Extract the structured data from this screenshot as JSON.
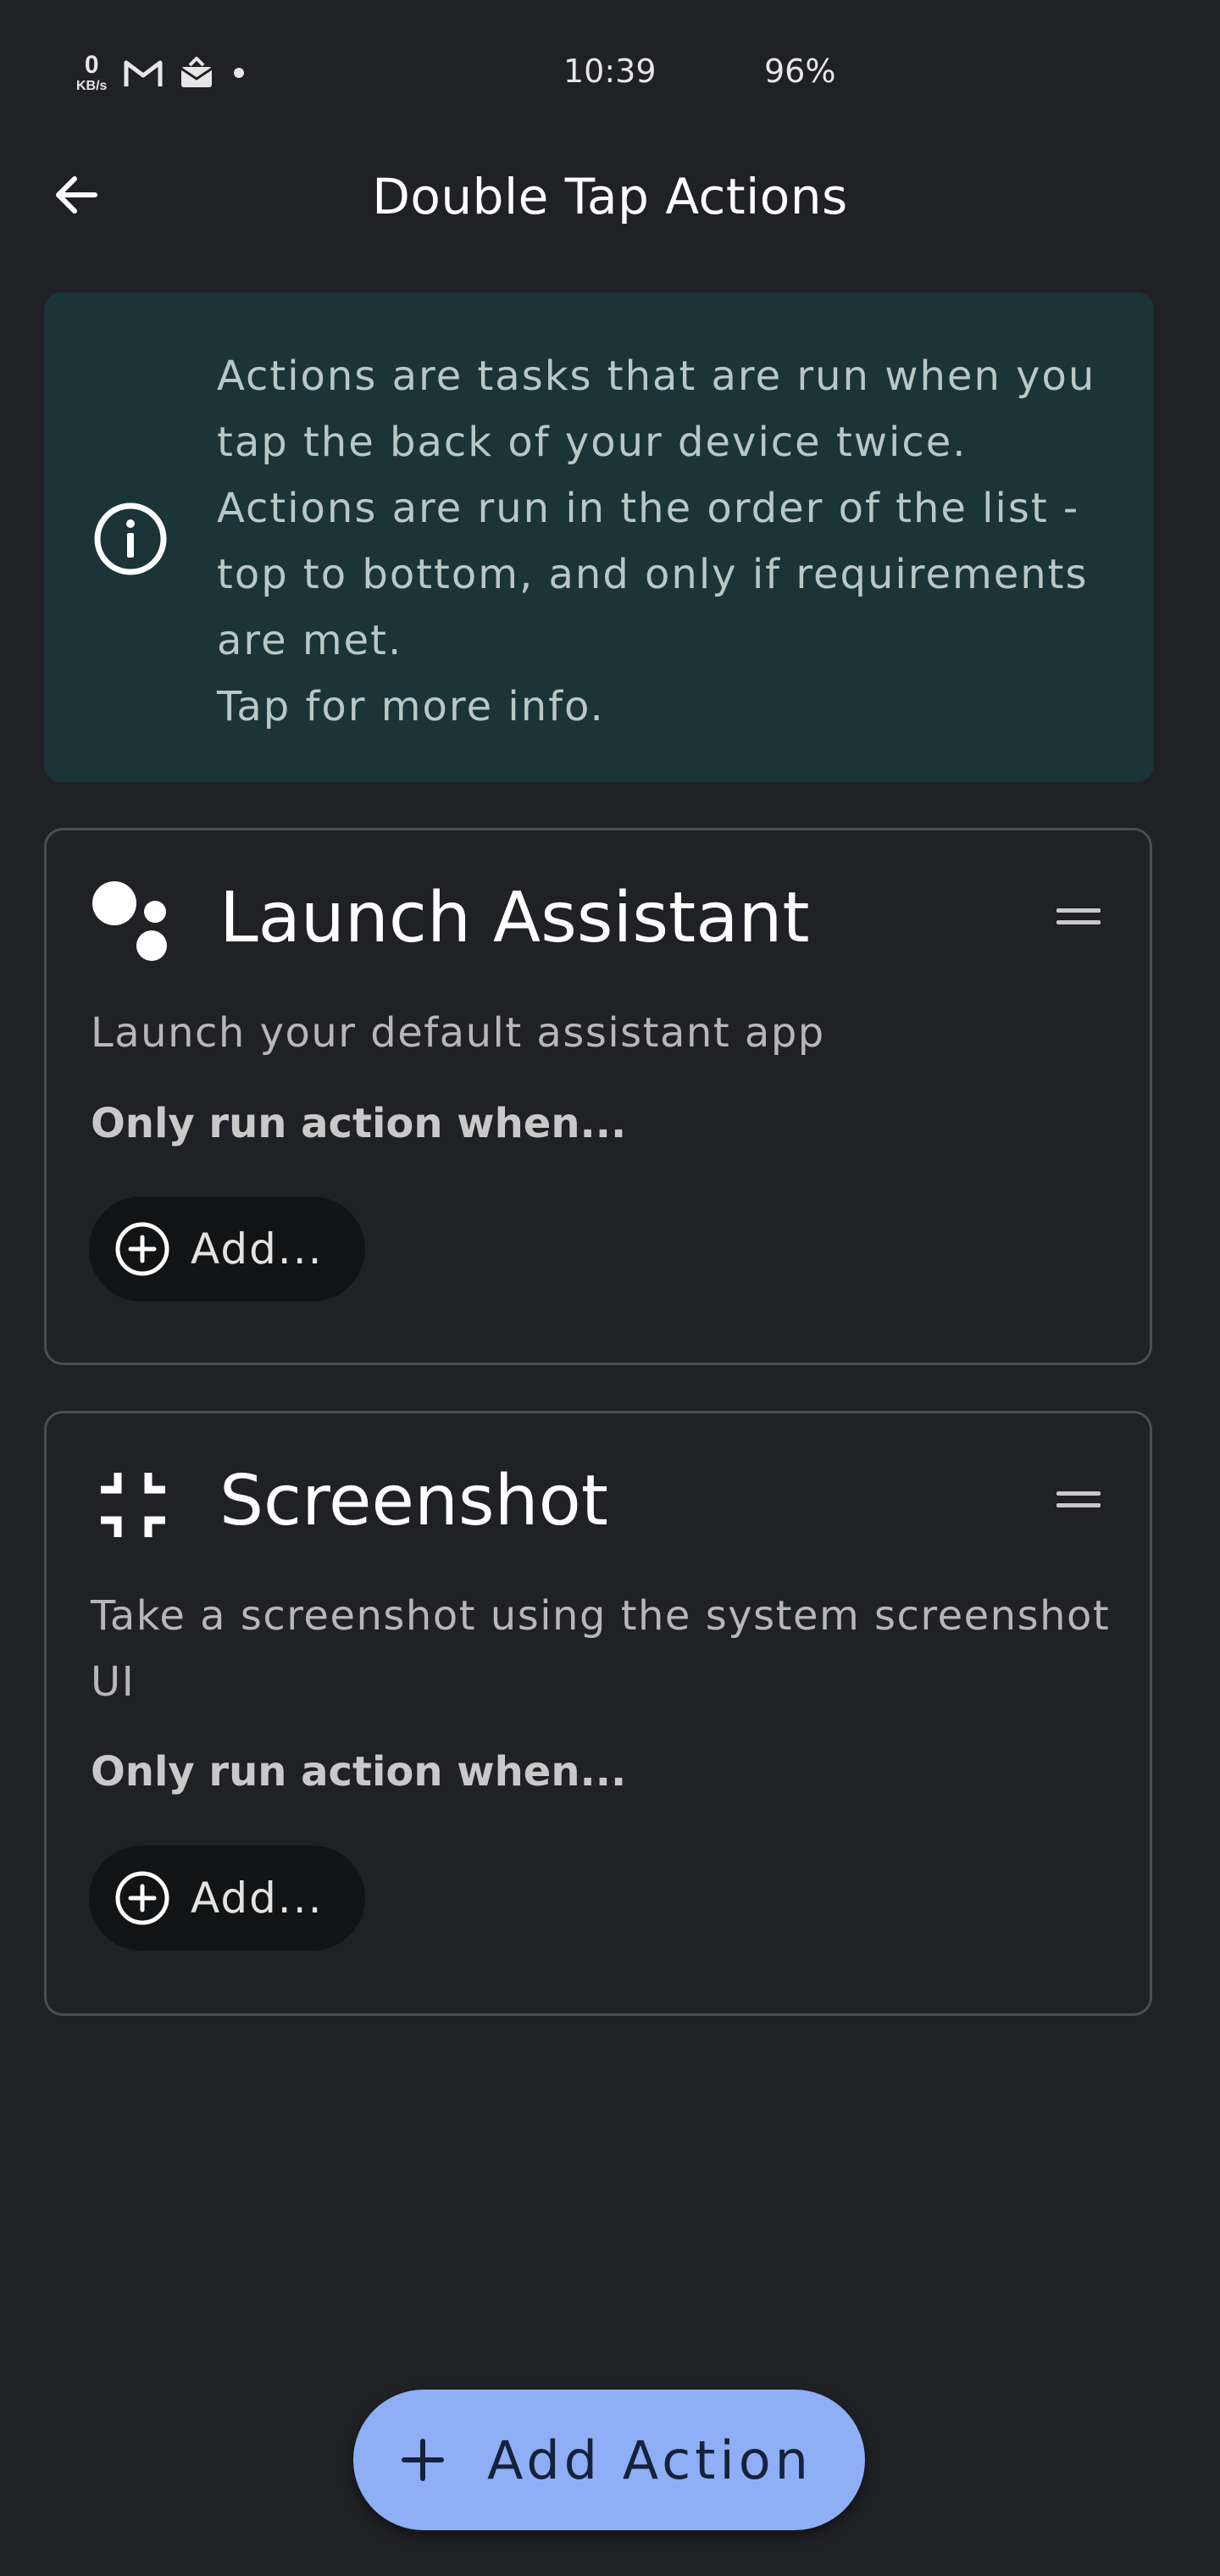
{
  "status_bar": {
    "net_speed_value": "0",
    "net_speed_unit": "KB/s",
    "notification_icons": [
      "gmail-icon",
      "mail-icon",
      "dot-icon"
    ],
    "time": "10:39",
    "battery": "96%"
  },
  "app_bar": {
    "back_icon": "arrow-back-icon",
    "title": "Double Tap Actions"
  },
  "info_banner": {
    "icon": "info-icon",
    "lines": [
      "Actions are tasks that are run when you",
      "tap the back of your device twice.",
      "Actions are run in the order of the list -",
      "top to bottom, and only if requirements",
      "are met.",
      "Tap for more info."
    ]
  },
  "actions": [
    {
      "icon": "assistant-icon",
      "title": "Launch Assistant",
      "description": "Launch your default assistant app",
      "requirement_label": "Only run action when...",
      "add_label": "Add..."
    },
    {
      "icon": "screenshot-icon",
      "title": "Screenshot",
      "description": "Take a screenshot using the system screenshot UI",
      "requirement_label": "Only run action when...",
      "add_label": "Add..."
    }
  ],
  "fab": {
    "icon": "plus-icon",
    "label": "Add Action"
  },
  "colors": {
    "background": "#202125",
    "banner": "#1b3438",
    "fab": "#8eaef6",
    "card_border": "#4b4d52"
  }
}
